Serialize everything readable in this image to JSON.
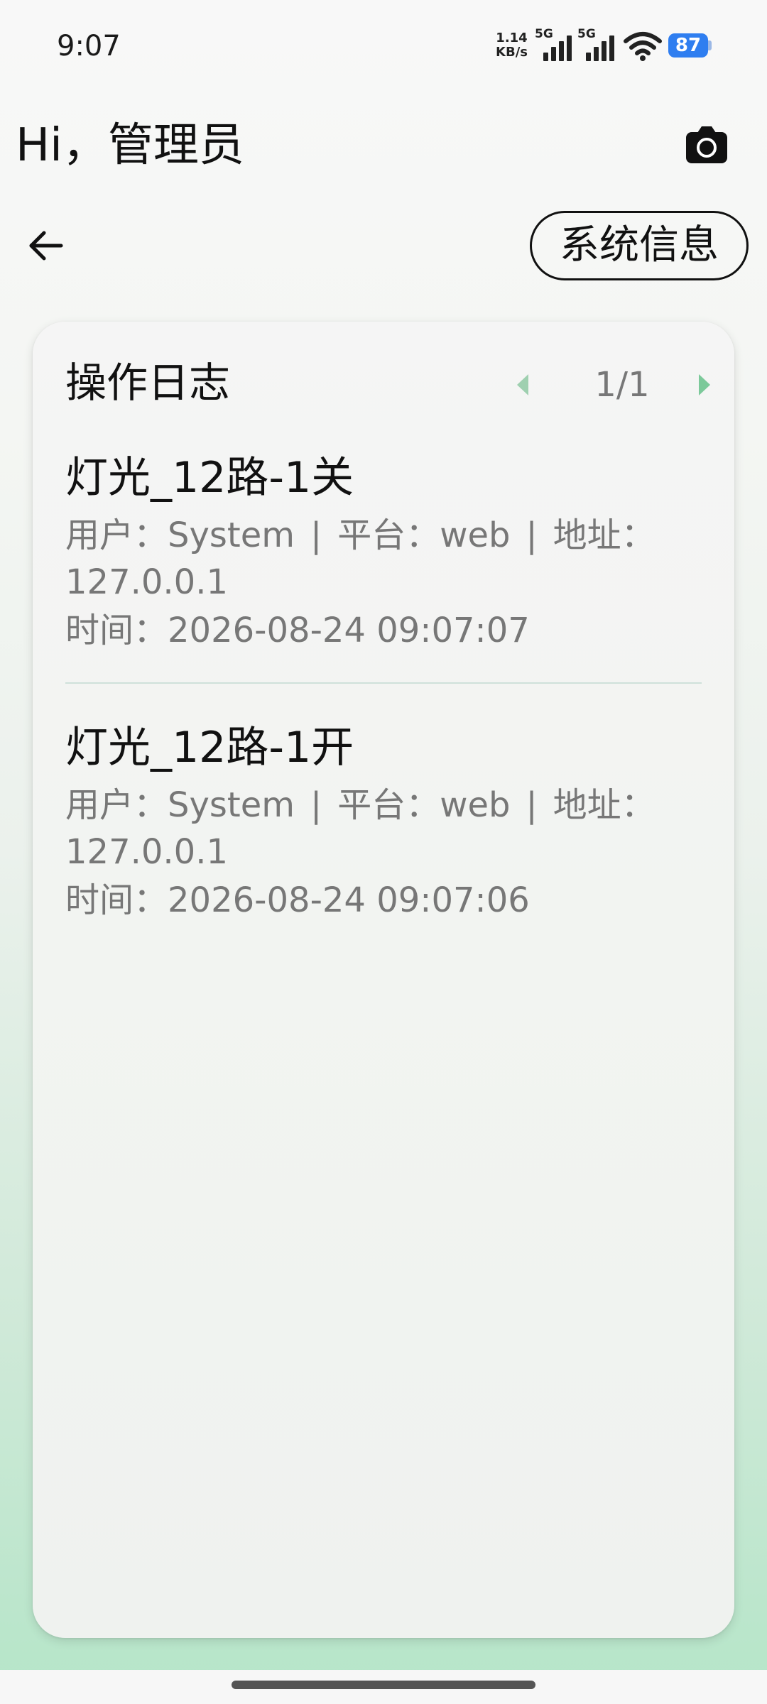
{
  "status_bar": {
    "time": "9:07",
    "net_speed_value": "1.14",
    "net_speed_unit": "KB/s",
    "sim1_label": "5G",
    "sim2_label": "5G",
    "battery_level": "87",
    "icons": [
      "signal-icon",
      "signal-icon",
      "wifi-icon",
      "battery-icon"
    ]
  },
  "header": {
    "greeting": "Hi，管理员",
    "camera_icon": "camera-icon"
  },
  "nav": {
    "back_icon": "arrow-left-icon",
    "system_info_label": "系统信息"
  },
  "log_card": {
    "title": "操作日志",
    "pager": {
      "text": "1/1",
      "prev_icon": "triangle-left-icon",
      "next_icon": "triangle-right-icon"
    },
    "items": [
      {
        "title": "灯光_12路-1关",
        "user_label": "用户：",
        "user": "System",
        "platform_label": "平台：",
        "platform": "web",
        "address_label": "地址：",
        "address": "127.0.0.1",
        "time_label": "时间：",
        "time": "2026-08-24 09:07:07"
      },
      {
        "title": "灯光_12路-1开",
        "user_label": "用户：",
        "user": "System",
        "platform_label": "平台：",
        "platform": "web",
        "address_label": "地址：",
        "address": "127.0.0.1",
        "time_label": "时间：",
        "time": "2026-08-24 09:07:06"
      }
    ],
    "separator": "|"
  },
  "colors": {
    "accent_green": "#7cc99a",
    "battery_blue": "#2f7ef0",
    "muted_text": "#777777"
  }
}
